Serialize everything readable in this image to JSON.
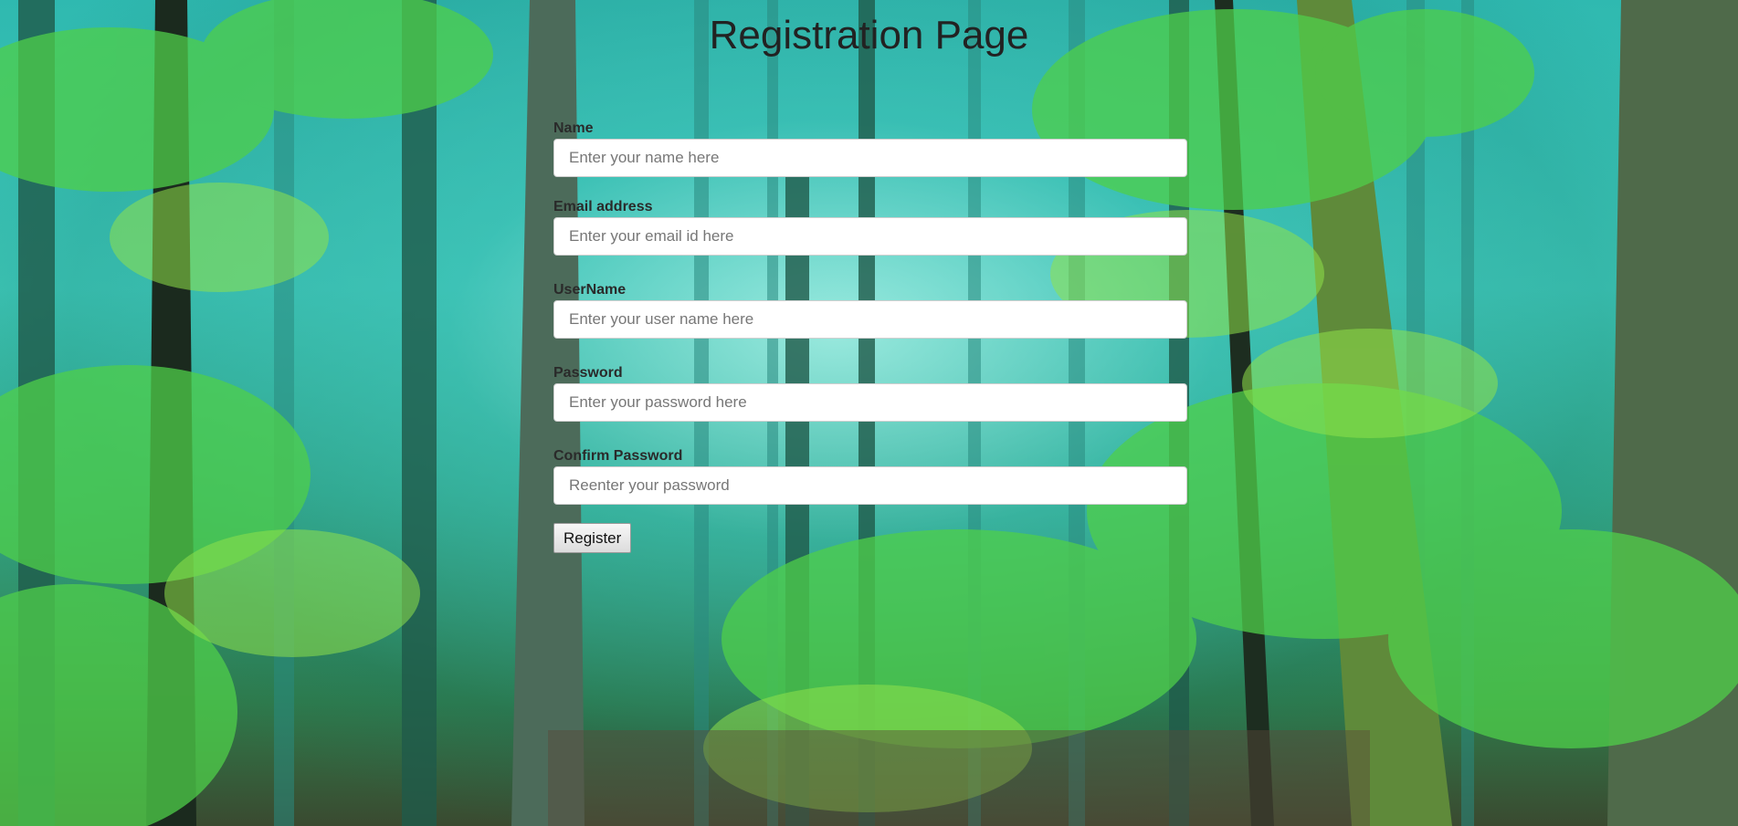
{
  "page": {
    "title": "Registration Page",
    "background": "forest-photo"
  },
  "form": {
    "fields": [
      {
        "label": "Name",
        "placeholder": "Enter your name here",
        "value": ""
      },
      {
        "label": "Email address",
        "placeholder": "Enter your email id here",
        "value": ""
      },
      {
        "label": "UserName",
        "placeholder": "Enter your user name here",
        "value": ""
      },
      {
        "label": "Password",
        "placeholder": "Enter your password here",
        "value": ""
      },
      {
        "label": "Confirm Password",
        "placeholder": "Reenter your password",
        "value": ""
      }
    ],
    "submit_label": "Register"
  },
  "colors": {
    "title_text": "#222222",
    "label_text": "#2a2a2a",
    "input_bg": "#ffffff"
  }
}
